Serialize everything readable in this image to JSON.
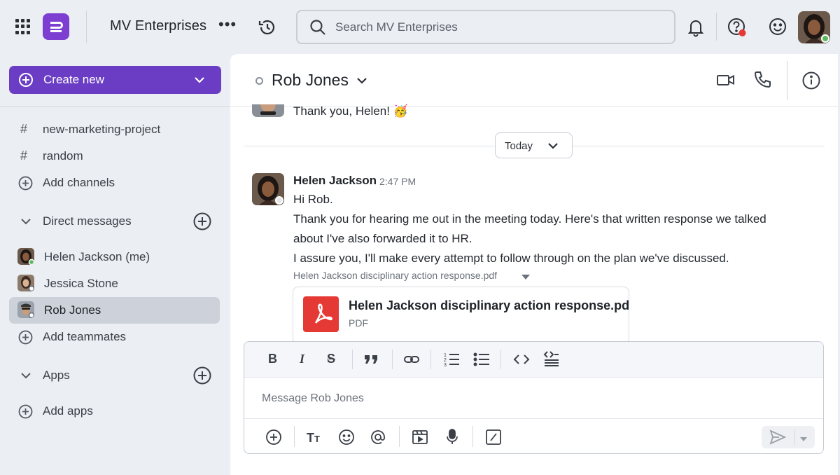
{
  "topbar": {
    "org_name": "MV Enterprises",
    "more": "•••",
    "search_placeholder": "Search MV Enterprises"
  },
  "sidebar": {
    "create_new": "Create new",
    "channels": [
      {
        "label": "new-marketing-project"
      },
      {
        "label": "random"
      }
    ],
    "add_channels": "Add channels",
    "direct_messages_header": "Direct messages",
    "dms": [
      {
        "label": "Helen Jackson (me)",
        "status": "online"
      },
      {
        "label": "Jessica Stone",
        "status": "offline"
      },
      {
        "label": "Rob Jones",
        "status": "offline",
        "active": true
      }
    ],
    "add_teammates": "Add teammates",
    "apps_header": "Apps",
    "add_apps": "Add apps"
  },
  "channel": {
    "title": "Rob Jones"
  },
  "messages": {
    "previous_text": "Thank you, Helen! 🥳",
    "date_divider": "Today",
    "author": "Helen Jackson",
    "time": "2:47 PM",
    "lines": [
      "Hi Rob.",
      "Thank you for hearing me out in the meeting today. Here's that written response we talked",
      "about I've also forwarded it to HR.",
      "I assure you, I'll make every attempt to follow through on the plan we've discussed."
    ],
    "attachment_caption": "Helen Jackson disciplinary action response.pdf",
    "attachment_name": "Helen Jackson disciplinary action response.pdf",
    "attachment_type": "PDF"
  },
  "composer": {
    "placeholder": "Message Rob Jones",
    "format_buttons": [
      "B",
      "I",
      "S",
      "quote",
      "link",
      "ordered-list",
      "bullet-list",
      "code",
      "code-block"
    ]
  },
  "colors": {
    "brand": "#6a3dc4",
    "pdf_red": "#e53935",
    "online": "#5cb85c",
    "alert": "#e53935"
  }
}
